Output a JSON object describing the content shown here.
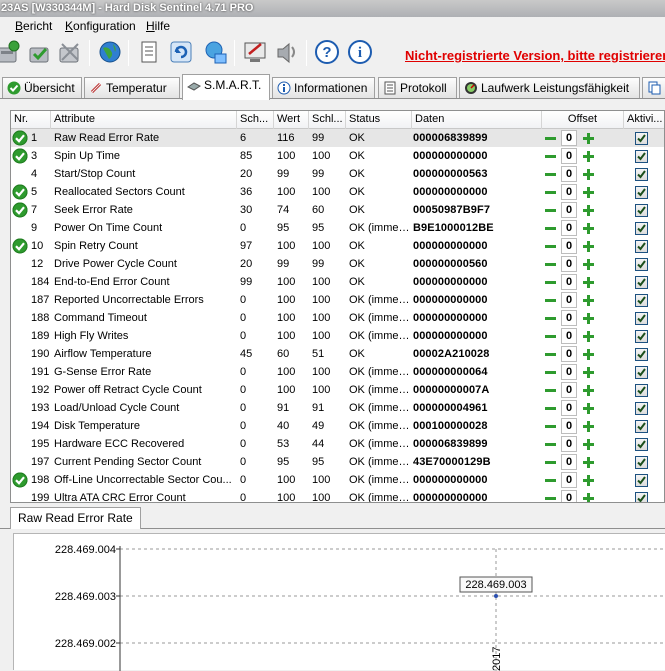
{
  "window": {
    "title": "23AS [W330344M]  -  Hard Disk Sentinel 4.71 PRO"
  },
  "menu": [
    {
      "label": "Bericht"
    },
    {
      "label": "Konfiguration"
    },
    {
      "label": "Hilfe"
    }
  ],
  "toolbar": {
    "warning": "Nicht-registrierte Version, bitte registrieren",
    "buttons": [
      "disk-check-icon",
      "disk-ok-icon",
      "disk-settings-icon",
      "globe-icon",
      "report-icon",
      "refresh-icon",
      "network-icon",
      "monitor-icon",
      "speaker-icon",
      "help-icon",
      "info-icon"
    ]
  },
  "tabs": [
    {
      "label": "Übersicht",
      "icon": "check-circle-icon"
    },
    {
      "label": "Temperatur",
      "icon": "thermometer-icon"
    },
    {
      "label": "S.M.A.R.T.",
      "icon": "smart-icon",
      "active": true
    },
    {
      "label": "Informationen",
      "icon": "info-icon"
    },
    {
      "label": "Protokoll",
      "icon": "log-icon"
    },
    {
      "label": "Laufwerk Leistungsfähigkeit",
      "icon": "gauge-icon"
    },
    {
      "label": "",
      "icon": "copy-icon"
    }
  ],
  "colors": {
    "accent_green": "#2e9b2e",
    "warning_red": "#e00000",
    "selection": "#e6e6e6"
  },
  "smart": {
    "columns": [
      "Nr.",
      "Attribute",
      "Sch...",
      "Wert",
      "Schl...",
      "Status",
      "Daten",
      "Offset",
      "Aktivi..."
    ],
    "rows": [
      {
        "ok": true,
        "nr": "1",
        "attr": "Raw Read Error Rate",
        "thr": "6",
        "val": "116",
        "worst": "99",
        "status": "OK",
        "data": "000006839899",
        "offset": "0",
        "active": true,
        "selected": true
      },
      {
        "ok": true,
        "nr": "3",
        "attr": "Spin Up Time",
        "thr": "85",
        "val": "100",
        "worst": "100",
        "status": "OK",
        "data": "000000000000",
        "offset": "0",
        "active": true
      },
      {
        "ok": false,
        "nr": "4",
        "attr": "Start/Stop Count",
        "thr": "20",
        "val": "99",
        "worst": "99",
        "status": "OK",
        "data": "000000000563",
        "offset": "0",
        "active": true
      },
      {
        "ok": true,
        "nr": "5",
        "attr": "Reallocated Sectors Count",
        "thr": "36",
        "val": "100",
        "worst": "100",
        "status": "OK",
        "data": "000000000000",
        "offset": "0",
        "active": true
      },
      {
        "ok": true,
        "nr": "7",
        "attr": "Seek Error Rate",
        "thr": "30",
        "val": "74",
        "worst": "60",
        "status": "OK",
        "data": "00050987B9F7",
        "offset": "0",
        "active": true
      },
      {
        "ok": false,
        "nr": "9",
        "attr": "Power On Time Count",
        "thr": "0",
        "val": "95",
        "worst": "95",
        "status": "OK (immer ...",
        "data": "B9E1000012BE",
        "offset": "0",
        "active": true
      },
      {
        "ok": true,
        "nr": "10",
        "attr": "Spin Retry Count",
        "thr": "97",
        "val": "100",
        "worst": "100",
        "status": "OK",
        "data": "000000000000",
        "offset": "0",
        "active": true
      },
      {
        "ok": false,
        "nr": "12",
        "attr": "Drive Power Cycle Count",
        "thr": "20",
        "val": "99",
        "worst": "99",
        "status": "OK",
        "data": "000000000560",
        "offset": "0",
        "active": true
      },
      {
        "ok": false,
        "nr": "184",
        "attr": "End-to-End Error Count",
        "thr": "99",
        "val": "100",
        "worst": "100",
        "status": "OK",
        "data": "000000000000",
        "offset": "0",
        "active": true
      },
      {
        "ok": false,
        "nr": "187",
        "attr": "Reported Uncorrectable Errors",
        "thr": "0",
        "val": "100",
        "worst": "100",
        "status": "OK (immer ...",
        "data": "000000000000",
        "offset": "0",
        "active": true
      },
      {
        "ok": false,
        "nr": "188",
        "attr": "Command Timeout",
        "thr": "0",
        "val": "100",
        "worst": "100",
        "status": "OK (immer ...",
        "data": "000000000000",
        "offset": "0",
        "active": true
      },
      {
        "ok": false,
        "nr": "189",
        "attr": "High Fly Writes",
        "thr": "0",
        "val": "100",
        "worst": "100",
        "status": "OK (immer ...",
        "data": "000000000000",
        "offset": "0",
        "active": true
      },
      {
        "ok": false,
        "nr": "190",
        "attr": "Airflow Temperature",
        "thr": "45",
        "val": "60",
        "worst": "51",
        "status": "OK",
        "data": "00002A210028",
        "offset": "0",
        "active": true
      },
      {
        "ok": false,
        "nr": "191",
        "attr": "G-Sense Error Rate",
        "thr": "0",
        "val": "100",
        "worst": "100",
        "status": "OK (immer ...",
        "data": "000000000064",
        "offset": "0",
        "active": true
      },
      {
        "ok": false,
        "nr": "192",
        "attr": "Power off Retract Cycle Count",
        "thr": "0",
        "val": "100",
        "worst": "100",
        "status": "OK (immer ...",
        "data": "00000000007A",
        "offset": "0",
        "active": true
      },
      {
        "ok": false,
        "nr": "193",
        "attr": "Load/Unload Cycle Count",
        "thr": "0",
        "val": "91",
        "worst": "91",
        "status": "OK (immer ...",
        "data": "000000004961",
        "offset": "0",
        "active": true
      },
      {
        "ok": false,
        "nr": "194",
        "attr": "Disk Temperature",
        "thr": "0",
        "val": "40",
        "worst": "49",
        "status": "OK (immer ...",
        "data": "000100000028",
        "offset": "0",
        "active": true
      },
      {
        "ok": false,
        "nr": "195",
        "attr": "Hardware ECC Recovered",
        "thr": "0",
        "val": "53",
        "worst": "44",
        "status": "OK (immer ...",
        "data": "000006839899",
        "offset": "0",
        "active": true
      },
      {
        "ok": false,
        "nr": "197",
        "attr": "Current Pending Sector Count",
        "thr": "0",
        "val": "95",
        "worst": "95",
        "status": "OK (immer ...",
        "data": "43E70000129B",
        "offset": "0",
        "active": true
      },
      {
        "ok": true,
        "nr": "198",
        "attr": "Off-Line Uncorrectable Sector Cou...",
        "thr": "0",
        "val": "100",
        "worst": "100",
        "status": "OK (immer ...",
        "data": "000000000000",
        "offset": "0",
        "active": true
      },
      {
        "ok": false,
        "nr": "199",
        "attr": "Ultra ATA CRC Error Count",
        "thr": "0",
        "val": "100",
        "worst": "100",
        "status": "OK (immer ...",
        "data": "000000000000",
        "offset": "0",
        "active": true
      }
    ]
  },
  "lower_tab": {
    "label": "Raw Read Error Rate"
  },
  "chart_data": {
    "type": "line",
    "title": "",
    "xlabel": "",
    "ylabel": "",
    "y_ticks": [
      "228.469.004",
      "228.469.003",
      "228.469.002"
    ],
    "ylim": [
      228469002,
      228469004
    ],
    "x_tick_label": "2017",
    "points": [
      {
        "x": "2017",
        "y": 228469003
      }
    ],
    "point_label": "228.469.003",
    "grid": true
  }
}
